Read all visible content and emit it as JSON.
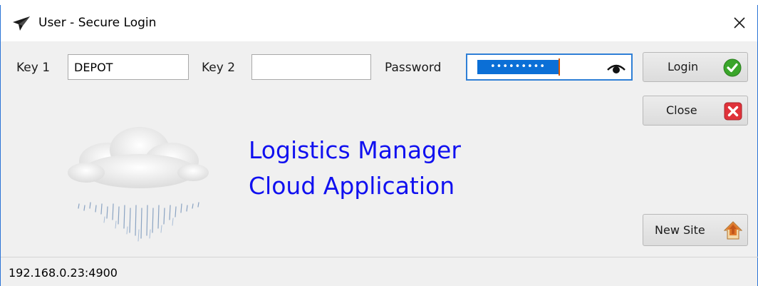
{
  "window": {
    "title": "User - Secure Login",
    "close_symbol": "✕",
    "app_icon": "paper-plane-icon"
  },
  "form": {
    "key1": {
      "label": "Key 1",
      "value": "DEPOT"
    },
    "key2": {
      "label": "Key 2",
      "value": ""
    },
    "password": {
      "label": "Password",
      "masked_value": "•••••••••",
      "reveal_icon": "eye-icon"
    }
  },
  "buttons": {
    "login": {
      "label": "Login",
      "icon": "check-circle-icon",
      "icon_color": "#3aa52a"
    },
    "close": {
      "label": "Close",
      "icon": "red-x-icon",
      "icon_color": "#e0323a"
    },
    "new_site": {
      "label": "New Site",
      "icon": "house-arrow-icon",
      "icon_color": "#d86a1a"
    }
  },
  "branding": {
    "line1": "Logistics Manager",
    "line2": "Cloud Application",
    "color": "#1010f0",
    "illustration": "rain-cloud-icon"
  },
  "status": {
    "address": "192.168.0.23:4900"
  },
  "colors": {
    "window_border": "#2b74d6",
    "focus_border": "#2f7fd6",
    "selection": "#0b6fd6"
  }
}
